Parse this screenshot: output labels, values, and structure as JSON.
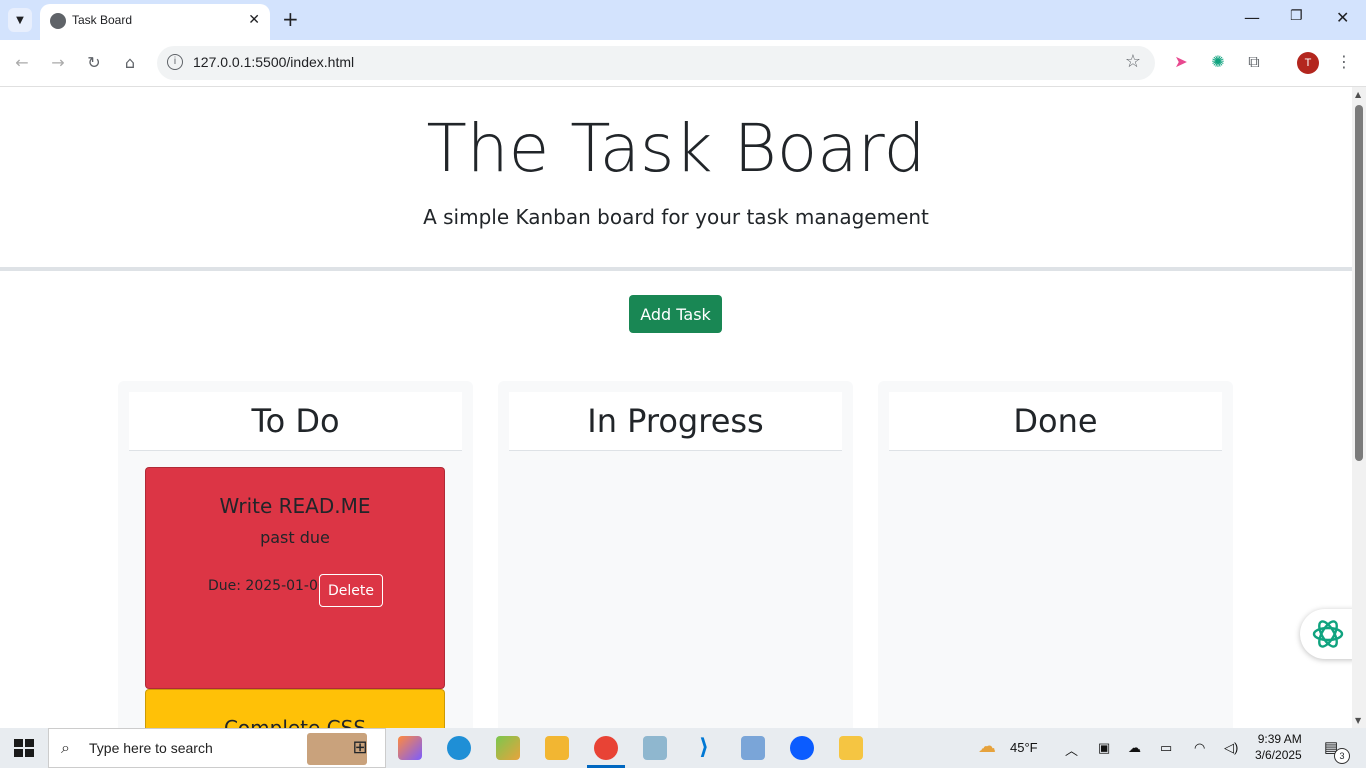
{
  "browser": {
    "tab_title": "Task Board",
    "url": "127.0.0.1:5500/index.html",
    "avatar_letter": "T"
  },
  "page": {
    "title": "The Task Board",
    "subtitle": "A simple Kanban board for your task management",
    "add_button": "Add Task",
    "lanes": [
      {
        "title": "To Do"
      },
      {
        "title": "In Progress"
      },
      {
        "title": "Done"
      }
    ],
    "cards": [
      {
        "title": "Write READ.ME",
        "description": "past due",
        "due": "Due: 2025-01-06",
        "delete_label": "Delete",
        "color": "#dc3545"
      },
      {
        "title": "Complete CSS",
        "color": "#ffc107"
      }
    ]
  },
  "taskbar": {
    "search_placeholder": "Type here to search",
    "weather": "45°F",
    "time": "9:39 AM",
    "date": "3/6/2025",
    "notification_count": "3"
  },
  "colors": {
    "primary_button": "#198754",
    "past_due": "#dc3545",
    "due_soon": "#ffc107",
    "lane_bg": "#f8f9fa"
  }
}
